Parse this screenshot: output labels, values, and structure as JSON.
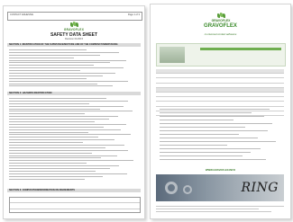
{
  "sds": {
    "header_left": "CONTACT ADHESIVE",
    "header_right": "Page 1 of 3",
    "brand": "GRAVOFLEX",
    "title": "SAFETY DATA SHEET",
    "subtitle": "Revision 01/2015",
    "sections": [
      "SECTION 1: IDENTIFICATION OF THE SUBSTANCE/MIXTURE AND OF THE COMPANY/UNDERTAKING",
      "SECTION 2: HAZARDS IDENTIFICATION",
      "SECTION 3: COMPOSITION/INFORMATION ON INGREDIENTS"
    ]
  },
  "flyer": {
    "brand": "GRAVOFLEX",
    "title": "GRAVOFLEX",
    "tagline": "A universal contact adhesive",
    "website": "WWW.GRAVOFLEX.INFO",
    "banner_word": "RING"
  }
}
